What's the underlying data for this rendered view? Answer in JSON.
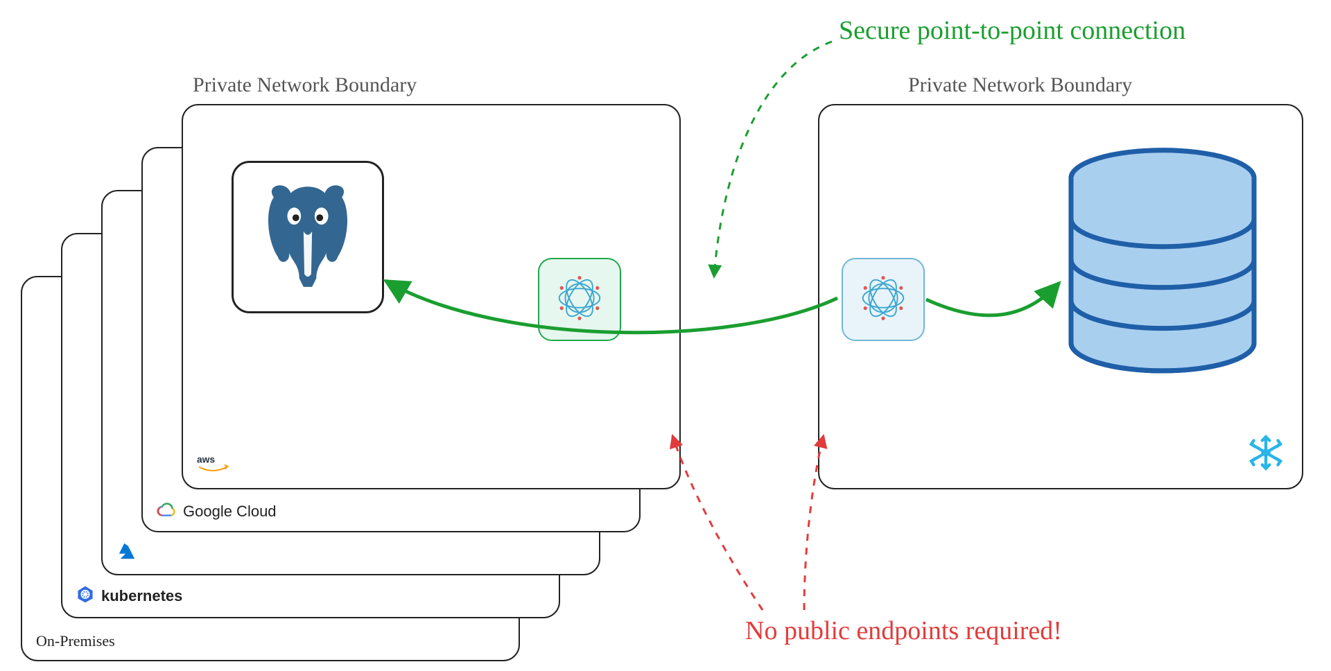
{
  "labels": {
    "left_boundary": "Private Network Boundary",
    "right_boundary": "Private Network Boundary"
  },
  "annotations": {
    "secure": "Secure point-to-point connection",
    "no_public": "No public endpoints required!"
  },
  "stack": {
    "aws": "aws",
    "gcp": "Google Cloud",
    "azure": "",
    "k8s": "kubernetes",
    "onprem": "On-Premises"
  },
  "icons": {
    "postgres": "postgres-elephant-icon",
    "connector_left": "mesh-connector-icon",
    "connector_right": "mesh-connector-icon",
    "database": "database-cylinder-icon",
    "snowflake": "snowflake-icon",
    "aws": "aws-icon",
    "gcp": "gcp-icon",
    "azure": "azure-icon",
    "k8s": "kubernetes-icon"
  },
  "colors": {
    "green": "#1a9e2f",
    "red": "#e23b3b",
    "blue_fill": "#a9cfef",
    "blue_stroke": "#1f5fa8",
    "postgres": "#336791",
    "snowflake": "#29b5e8"
  }
}
